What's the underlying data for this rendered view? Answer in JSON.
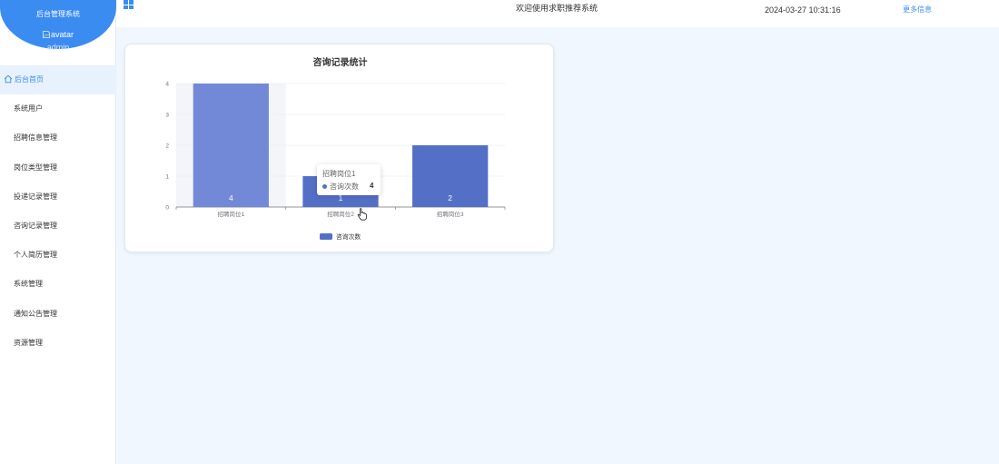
{
  "sidebar": {
    "brand_title": "后台管理系统",
    "avatar_alt": "avatar",
    "username": "admin",
    "items": [
      {
        "label": "后台首页",
        "icon": "home-icon",
        "active": true
      },
      {
        "label": "系统用户"
      },
      {
        "label": "招聘信息管理"
      },
      {
        "label": "岗位类型管理"
      },
      {
        "label": "投递记录管理"
      },
      {
        "label": "咨询记录管理"
      },
      {
        "label": "个人简历管理"
      },
      {
        "label": "系统管理"
      },
      {
        "label": "通知公告管理"
      },
      {
        "label": "资源管理"
      }
    ]
  },
  "header": {
    "menu_icon": "grid-icon",
    "welcome": "欢迎使用求职推荐系统",
    "datetime": "2024-03-27 10:31:16",
    "more_info": "更多信息"
  },
  "colors": {
    "accent": "#3b8cf0",
    "bar": "#5470c6",
    "bar_highlight": "#7189d6"
  },
  "chart_data": {
    "type": "bar",
    "title": "咨询记录统计",
    "categories": [
      "招聘岗位1",
      "招聘岗位2",
      "招聘岗位3"
    ],
    "series": [
      {
        "name": "咨询次数",
        "values": [
          4,
          1,
          2
        ]
      }
    ],
    "yticks": [
      0,
      1,
      2,
      3,
      4
    ],
    "ylim": [
      0,
      4
    ],
    "grid": true,
    "legend": "bottom-center",
    "highlighted_index": 0
  },
  "tooltip": {
    "title": "招聘岗位1",
    "series_name": "咨询次数",
    "value": "4"
  }
}
